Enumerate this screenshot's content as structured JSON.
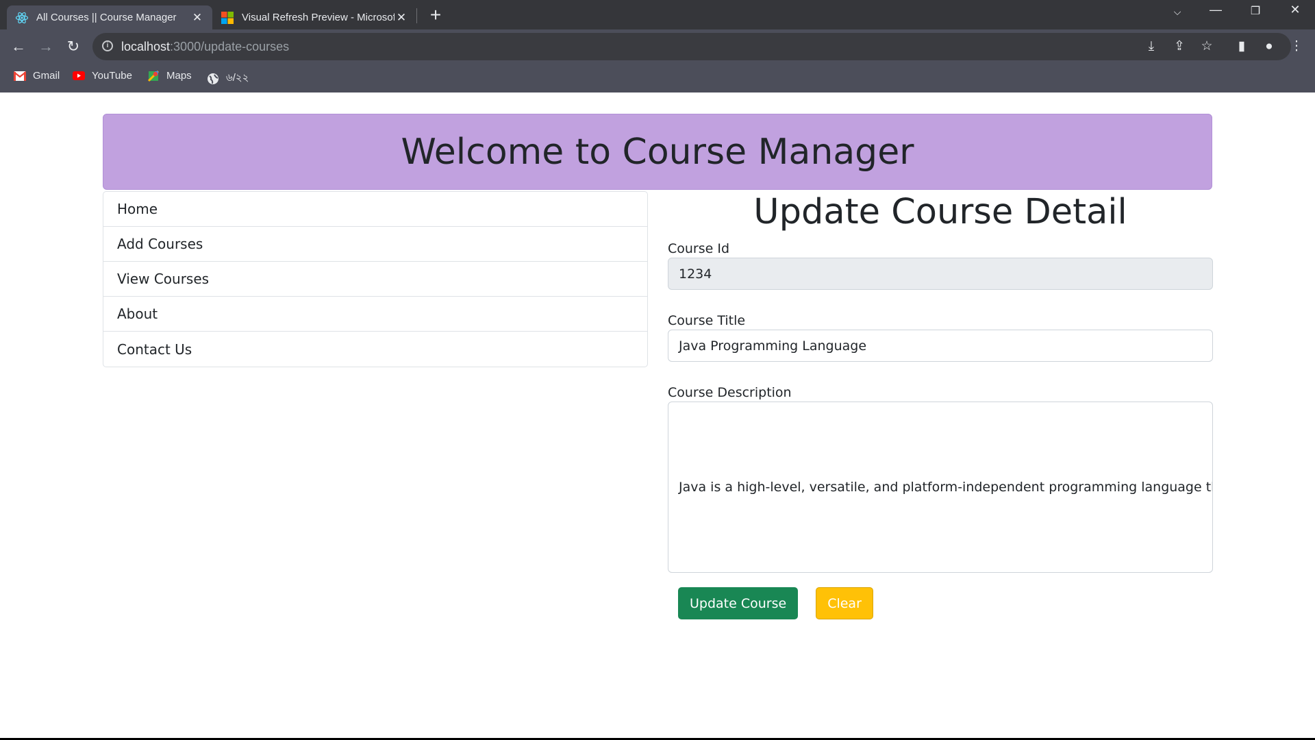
{
  "browser": {
    "tabs": [
      {
        "title": "All Courses || Course Manager",
        "active": true,
        "favicon": "react-icon"
      },
      {
        "title": "Visual Refresh Preview - Microsof",
        "active": false,
        "favicon": "microsoft-icon"
      }
    ],
    "url_host": "localhost",
    "url_path": ":3000/update-courses",
    "bookmarks": [
      {
        "label": "Gmail",
        "icon": "gmail-icon"
      },
      {
        "label": "YouTube",
        "icon": "youtube-icon"
      },
      {
        "label": "Maps",
        "icon": "maps-icon"
      },
      {
        "label": "৬/২২",
        "icon": "globe-icon"
      }
    ]
  },
  "banner": {
    "title": "Welcome to Course Manager"
  },
  "menu": {
    "items": [
      {
        "label": "Home"
      },
      {
        "label": "Add Courses"
      },
      {
        "label": "View Courses"
      },
      {
        "label": "About"
      },
      {
        "label": "Contact Us"
      }
    ]
  },
  "form": {
    "heading": "Update Course Detail",
    "course_id_label": "Course Id",
    "course_id_value": "1234",
    "course_title_label": "Course Title",
    "course_title_value": "Java Programming Language",
    "course_description_label": "Course Description",
    "course_description_value": "Java is a high-level, versatile, and platform-independent programming language that w",
    "update_button": "Update Course",
    "clear_button": "Clear"
  },
  "colors": {
    "banner_bg": "#c1a1df",
    "success": "#198754",
    "warning": "#ffc107",
    "chrome_dark": "#35363a",
    "chrome_toolbar": "#4c4e5a"
  }
}
